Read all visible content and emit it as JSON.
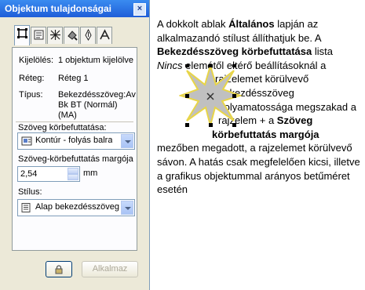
{
  "window": {
    "title": "Objektum tulajdonságai",
    "close_icon": "close-x-icon"
  },
  "tabs": [
    {
      "name": "general-tab",
      "icon": "general-icon",
      "active": true
    },
    {
      "name": "detail-tab",
      "icon": "detail-icon",
      "active": false
    },
    {
      "name": "fill-tab",
      "icon": "fill-icon",
      "active": false
    },
    {
      "name": "outline-tab",
      "icon": "outline-icon",
      "active": false
    },
    {
      "name": "pen-tab",
      "icon": "pen-icon",
      "active": false
    },
    {
      "name": "text-tab",
      "icon": "text-icon",
      "active": false
    }
  ],
  "props": {
    "selection_label": "Kijelölés:",
    "selection_value": "1 objektum kijelölve",
    "layer_label": "Réteg:",
    "layer_value": "Réteg 1",
    "type_label": "Típus:",
    "type_value_1": "Bekezdésszöveg:Av",
    "type_value_2": "Bk BT (Normál)",
    "type_value_3": "(MA)"
  },
  "wrap": {
    "label": "Szöveg körbefuttatása:",
    "value": "Kontúr - folyás balra",
    "margin_label": "Szöveg-körbefuttatás margója",
    "margin_value": "2,54",
    "unit": "mm"
  },
  "style": {
    "label": "Stílus:",
    "value": "Alap bekezdésszöveg ("
  },
  "buttons": {
    "lock_icon": "lock-icon",
    "apply": "Alkalmaz"
  },
  "doc": {
    "p1": "A dokkolt ablak",
    "p1b": "Általános",
    "p1c": "lapján az alkalmazandó stílust állíthatjuk be. A",
    "p2b": "Bekezdésszöveg körbefuttatása",
    "p2c": "lista",
    "l1": "Nincs",
    "l1b": " elemétől eltérő beállításoknál a",
    "l2": "rajzelemet körülvevő",
    "l3": "bekezdésszöveg",
    "l4": "folyamatossága megszakad a",
    "l5": "rajzelem + a",
    "l5b": "Szöveg",
    "l6b": "körbefuttatás margója",
    "l7": "mezőben megadott, a rajzelemet körülvevő sávon. A hatás csak megfelelően kicsi, illetve a grafikus objektummal arányos betűméret esetén"
  },
  "colors": {
    "titlebar": "#2462dd",
    "star_fill": "#c0c0c0",
    "star_outline": "#e8d548"
  }
}
